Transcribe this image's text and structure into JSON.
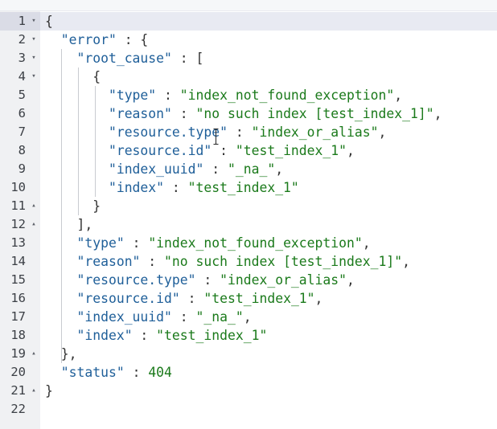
{
  "editor": {
    "lines": [
      {
        "num": "1",
        "fold": "▾",
        "indent": "",
        "tokens": [
          {
            "t": "p",
            "v": "{"
          }
        ]
      },
      {
        "num": "2",
        "fold": "▾",
        "indent": "  ",
        "tokens": [
          {
            "t": "k",
            "v": "\"error\""
          },
          {
            "t": "p",
            "v": " : {"
          }
        ]
      },
      {
        "num": "3",
        "fold": "▾",
        "indent": "    ",
        "tokens": [
          {
            "t": "k",
            "v": "\"root_cause\""
          },
          {
            "t": "p",
            "v": " : ["
          }
        ]
      },
      {
        "num": "4",
        "fold": "▾",
        "indent": "      ",
        "tokens": [
          {
            "t": "p",
            "v": "{"
          }
        ]
      },
      {
        "num": "5",
        "fold": "",
        "indent": "        ",
        "tokens": [
          {
            "t": "k",
            "v": "\"type\""
          },
          {
            "t": "p",
            "v": " : "
          },
          {
            "t": "s",
            "v": "\"index_not_found_exception\""
          },
          {
            "t": "p",
            "v": ","
          }
        ]
      },
      {
        "num": "6",
        "fold": "",
        "indent": "        ",
        "tokens": [
          {
            "t": "k",
            "v": "\"reason\""
          },
          {
            "t": "p",
            "v": " : "
          },
          {
            "t": "s",
            "v": "\"no such index [test_index_1]\""
          },
          {
            "t": "p",
            "v": ","
          }
        ]
      },
      {
        "num": "7",
        "fold": "",
        "indent": "        ",
        "tokens": [
          {
            "t": "k",
            "v": "\"resource.type\""
          },
          {
            "t": "p",
            "v": " : "
          },
          {
            "t": "s",
            "v": "\"index_or_alias\""
          },
          {
            "t": "p",
            "v": ","
          }
        ]
      },
      {
        "num": "8",
        "fold": "",
        "indent": "        ",
        "tokens": [
          {
            "t": "k",
            "v": "\"resource.id\""
          },
          {
            "t": "p",
            "v": " : "
          },
          {
            "t": "s",
            "v": "\"test_index_1\""
          },
          {
            "t": "p",
            "v": ","
          }
        ]
      },
      {
        "num": "9",
        "fold": "",
        "indent": "        ",
        "tokens": [
          {
            "t": "k",
            "v": "\"index_uuid\""
          },
          {
            "t": "p",
            "v": " : "
          },
          {
            "t": "s",
            "v": "\"_na_\""
          },
          {
            "t": "p",
            "v": ","
          }
        ]
      },
      {
        "num": "10",
        "fold": "",
        "indent": "        ",
        "tokens": [
          {
            "t": "k",
            "v": "\"index\""
          },
          {
            "t": "p",
            "v": " : "
          },
          {
            "t": "s",
            "v": "\"test_index_1\""
          }
        ]
      },
      {
        "num": "11",
        "fold": "▴",
        "indent": "      ",
        "tokens": [
          {
            "t": "p",
            "v": "}"
          }
        ]
      },
      {
        "num": "12",
        "fold": "▴",
        "indent": "    ",
        "tokens": [
          {
            "t": "p",
            "v": "],"
          }
        ]
      },
      {
        "num": "13",
        "fold": "",
        "indent": "    ",
        "tokens": [
          {
            "t": "k",
            "v": "\"type\""
          },
          {
            "t": "p",
            "v": " : "
          },
          {
            "t": "s",
            "v": "\"index_not_found_exception\""
          },
          {
            "t": "p",
            "v": ","
          }
        ]
      },
      {
        "num": "14",
        "fold": "",
        "indent": "    ",
        "tokens": [
          {
            "t": "k",
            "v": "\"reason\""
          },
          {
            "t": "p",
            "v": " : "
          },
          {
            "t": "s",
            "v": "\"no such index [test_index_1]\""
          },
          {
            "t": "p",
            "v": ","
          }
        ]
      },
      {
        "num": "15",
        "fold": "",
        "indent": "    ",
        "tokens": [
          {
            "t": "k",
            "v": "\"resource.type\""
          },
          {
            "t": "p",
            "v": " : "
          },
          {
            "t": "s",
            "v": "\"index_or_alias\""
          },
          {
            "t": "p",
            "v": ","
          }
        ]
      },
      {
        "num": "16",
        "fold": "",
        "indent": "    ",
        "tokens": [
          {
            "t": "k",
            "v": "\"resource.id\""
          },
          {
            "t": "p",
            "v": " : "
          },
          {
            "t": "s",
            "v": "\"test_index_1\""
          },
          {
            "t": "p",
            "v": ","
          }
        ]
      },
      {
        "num": "17",
        "fold": "",
        "indent": "    ",
        "tokens": [
          {
            "t": "k",
            "v": "\"index_uuid\""
          },
          {
            "t": "p",
            "v": " : "
          },
          {
            "t": "s",
            "v": "\"_na_\""
          },
          {
            "t": "p",
            "v": ","
          }
        ]
      },
      {
        "num": "18",
        "fold": "",
        "indent": "    ",
        "tokens": [
          {
            "t": "k",
            "v": "\"index\""
          },
          {
            "t": "p",
            "v": " : "
          },
          {
            "t": "s",
            "v": "\"test_index_1\""
          }
        ]
      },
      {
        "num": "19",
        "fold": "▴",
        "indent": "  ",
        "tokens": [
          {
            "t": "p",
            "v": "},"
          }
        ]
      },
      {
        "num": "20",
        "fold": "",
        "indent": "  ",
        "tokens": [
          {
            "t": "k",
            "v": "\"status\""
          },
          {
            "t": "p",
            "v": " : "
          },
          {
            "t": "n",
            "v": "404"
          }
        ]
      },
      {
        "num": "21",
        "fold": "▴",
        "indent": "",
        "tokens": [
          {
            "t": "p",
            "v": "}"
          }
        ]
      },
      {
        "num": "22",
        "fold": "",
        "indent": "",
        "tokens": []
      }
    ]
  }
}
